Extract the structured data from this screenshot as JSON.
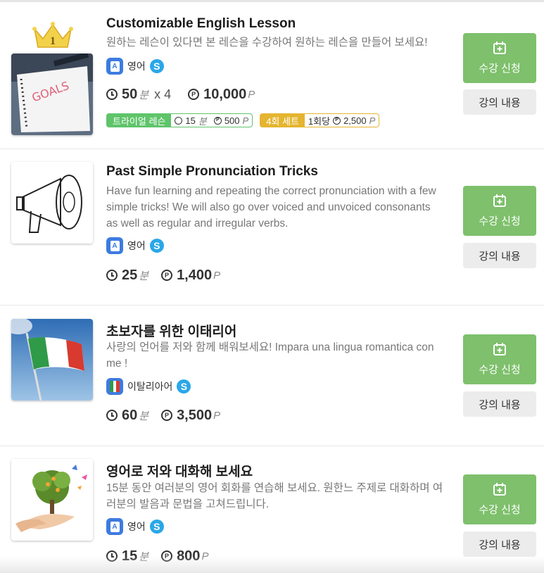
{
  "buttons": {
    "enroll_label": "수강 신청",
    "content_label": "강의 내용"
  },
  "lessons": [
    {
      "rank": "1",
      "title": "Customizable English Lesson",
      "description": "원하는 레슨이 있다면 본 레슨을 수강하여 원하는 레슨을 만들어 보세요!",
      "language": "영어",
      "language_icon": "A",
      "duration": "50",
      "duration_unit": "분",
      "multiplier": "x 4",
      "price": "10,000",
      "price_unit": "P",
      "trial": {
        "label": "트라이얼 레슨",
        "duration": "15",
        "unit": "분",
        "price": "500",
        "price_unit": "P"
      },
      "set": {
        "label": "4회 세트",
        "per": "1회당",
        "price": "2,500",
        "price_unit": "P"
      }
    },
    {
      "title": "Past Simple Pronunciation Tricks",
      "description": "Have fun learning and repeating the correct pronunciation with a few simple tricks! We will also go over voiced and unvoiced consonants as well as regular and irregular verbs.",
      "language": "영어",
      "language_icon": "A",
      "duration": "25",
      "duration_unit": "분",
      "price": "1,400",
      "price_unit": "P"
    },
    {
      "title": "초보자를 위한 이태리어",
      "description": "사랑의 언어를 저와 함께 배워보세요! Impara una lingua romantica con me !",
      "language": "이탈리아어",
      "duration": "60",
      "duration_unit": "분",
      "price": "3,500",
      "price_unit": "P"
    },
    {
      "title": "영어로 저와 대화해 보세요",
      "description": "15분 동안 여러분의 영어 회화를 연습해 보세요. 원한느 주제로 대화하며 여러분의 발음과 문법을 고쳐드립니다.",
      "language": "영어",
      "language_icon": "A",
      "duration": "15",
      "duration_unit": "분",
      "price": "800",
      "price_unit": "P"
    }
  ],
  "icons": {
    "skype": "S",
    "coin": "P"
  },
  "colors": {
    "enroll_button": "#7ec06c",
    "trial_badge": "#5fc46a",
    "set_badge": "#e5b531",
    "language_icon": "#3d7be0",
    "skype": "#2aa7e8"
  }
}
